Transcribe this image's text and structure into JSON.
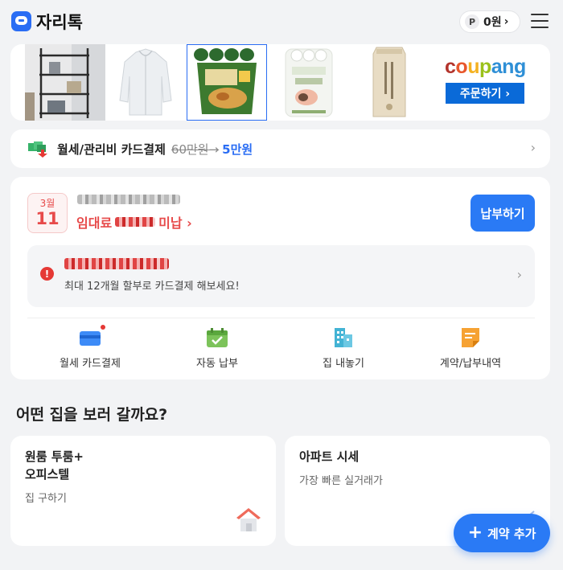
{
  "header": {
    "app_title": "자리톡",
    "point_badge": "P",
    "point_value": "0원",
    "point_chevron": "›",
    "logo_icon": "chat-bubble-icon",
    "menu_icon": "hamburger-menu-icon"
  },
  "ad": {
    "brand": [
      "c",
      "o",
      "u",
      "p",
      "a",
      "n",
      "g"
    ],
    "brand_colors": [
      "#b3342c",
      "#e8572c",
      "#f4b120",
      "#9bc11b",
      "#2e8fd6",
      "#2e8fd6",
      "#2e8fd6"
    ],
    "order_label": "주문하기 ›",
    "products": [
      "shelf-product",
      "jacket-product",
      "ramen-product",
      "toilet-paper-product",
      "rice-bag-product"
    ]
  },
  "promo": {
    "text": "월세/관리비 카드결제",
    "old_price": "60만원",
    "arrow": "→",
    "new_price": "5만원",
    "chevron": "›"
  },
  "rent": {
    "month": "3월",
    "day": "11",
    "status_prefix": "임대료",
    "status_suffix": "미납 ›",
    "pay_label": "납부하기",
    "warn_icon": "!",
    "warn_sub": "최대 12개월 할부로 카드결제 해보세요!",
    "warn_chevron": "›",
    "quick": [
      {
        "label": "월세 카드결제",
        "icon": "credit-card-icon"
      },
      {
        "label": "자동 납부",
        "icon": "calendar-check-icon"
      },
      {
        "label": "집 내놓기",
        "icon": "building-icon"
      },
      {
        "label": "계약/납부내역",
        "icon": "document-icon"
      }
    ]
  },
  "houses": {
    "section_title": "어떤 집을 보러 갈까요?",
    "cards": [
      {
        "title_line1": "원룸 투룸+",
        "title_line2": "오피스텔",
        "sub": "집 구하기"
      },
      {
        "title_line1": "아파트 시세",
        "title_line2": "",
        "sub": "가장 빠른 실거래가"
      }
    ]
  },
  "fab": {
    "plus": "+",
    "label": "계약 추가"
  },
  "colors": {
    "accent": "#2a7af5",
    "alert": "#e74a4a",
    "background": "#f2f3f5"
  }
}
